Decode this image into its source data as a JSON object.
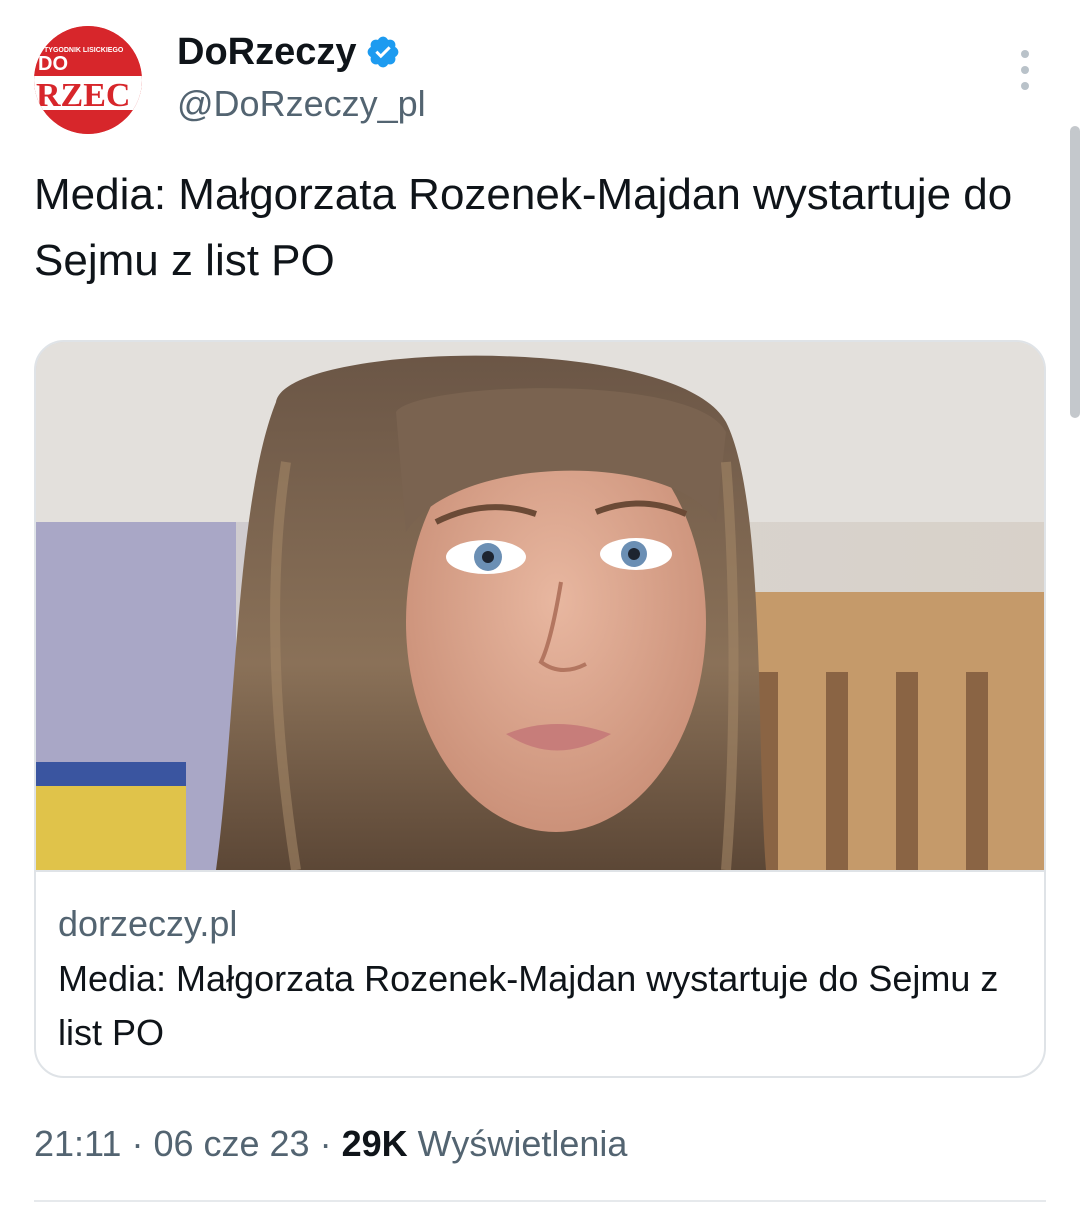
{
  "colors": {
    "verified_badge": "#1d9bf0",
    "text_primary": "#0f1419",
    "text_secondary": "#536471",
    "avatar_brand": "#d7262b"
  },
  "author": {
    "display_name": "DoRzeczy",
    "handle": "@DoRzeczy_pl",
    "verified_icon": "verified-badge-icon",
    "avatar_text_top": "TYGODNIK LISICKIEGO",
    "avatar_text_mid": "DO",
    "avatar_text_main": "RZEC"
  },
  "tweet": {
    "text": "Media: Małgorzata Rozenek-Majdan wystartuje do Sejmu z list PO"
  },
  "card": {
    "domain": "dorzeczy.pl",
    "title": "Media: Małgorzata Rozenek-Majdan wystartuje do Sejmu z list PO"
  },
  "meta": {
    "time": "21:11",
    "separator": "·",
    "date": "06 cze 23",
    "views_count": "29K",
    "views_label": "Wyświetlenia"
  },
  "icons": {
    "more": "more-vertical-icon"
  }
}
